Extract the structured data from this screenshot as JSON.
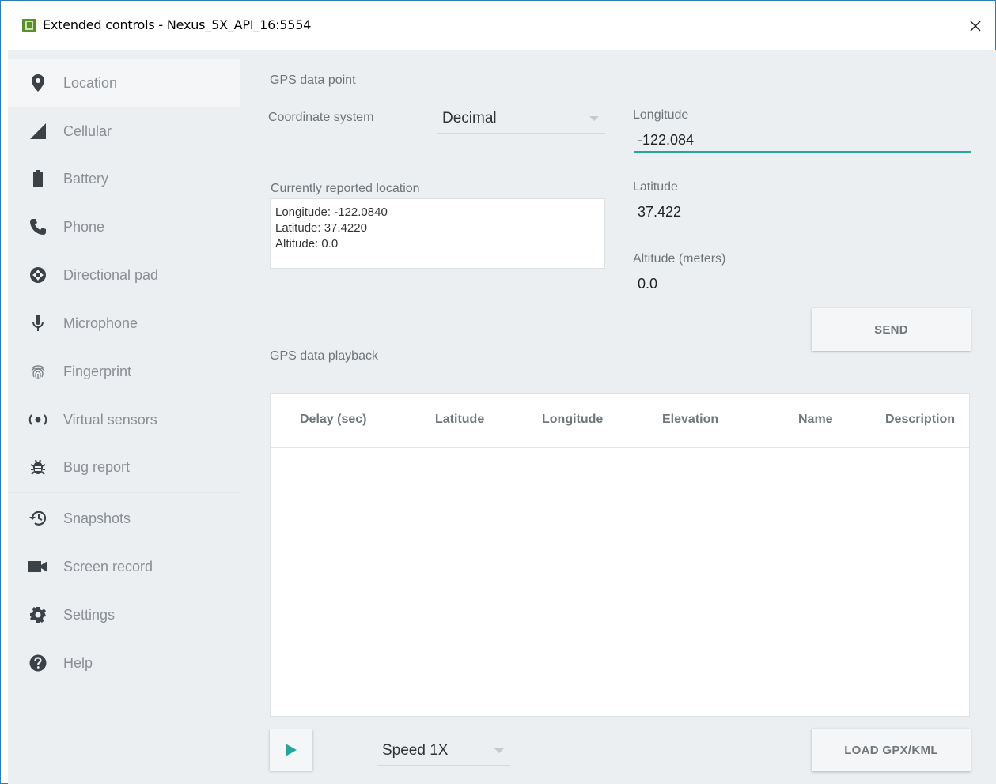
{
  "window": {
    "title": "Extended controls - Nexus_5X_API_16:5554",
    "close_glyph": "✕"
  },
  "sidebar": {
    "items": [
      {
        "label": "Location",
        "icon": "location-pin-icon"
      },
      {
        "label": "Cellular",
        "icon": "cellular-signal-icon"
      },
      {
        "label": "Battery",
        "icon": "battery-icon"
      },
      {
        "label": "Phone",
        "icon": "phone-icon"
      },
      {
        "label": "Directional pad",
        "icon": "dpad-icon"
      },
      {
        "label": "Microphone",
        "icon": "microphone-icon"
      },
      {
        "label": "Fingerprint",
        "icon": "fingerprint-icon"
      },
      {
        "label": "Virtual sensors",
        "icon": "virtual-sensors-icon"
      },
      {
        "label": "Bug report",
        "icon": "bug-icon"
      },
      {
        "label": "Snapshots",
        "icon": "snapshot-history-icon"
      },
      {
        "label": "Screen record",
        "icon": "video-camera-icon"
      },
      {
        "label": "Settings",
        "icon": "gear-icon"
      },
      {
        "label": "Help",
        "icon": "help-icon"
      }
    ],
    "active_item": "Location"
  },
  "gps_point": {
    "section_title": "GPS data point",
    "coord_system_label": "Coordinate system",
    "coord_system_value": "Decimal",
    "longitude_label": "Longitude",
    "longitude_value": "-122.084",
    "latitude_label": "Latitude",
    "latitude_value": "37.422",
    "altitude_label": "Altitude (meters)",
    "altitude_value": "0.0",
    "reported_label": "Currently reported location",
    "reported_lines": [
      "Longitude: -122.0840",
      "Latitude: 37.4220",
      "Altitude: 0.0"
    ],
    "send_label": "SEND"
  },
  "playback": {
    "section_title": "GPS data playback",
    "columns": [
      "Delay (sec)",
      "Latitude",
      "Longitude",
      "Elevation",
      "Name",
      "Description"
    ],
    "rows": [],
    "speed_value": "Speed 1X",
    "load_label": "LOAD GPX/KML"
  },
  "colors": {
    "accent": "#26a69a",
    "panel_bg": "#eceff1",
    "window_border": "#2a7fb6"
  }
}
